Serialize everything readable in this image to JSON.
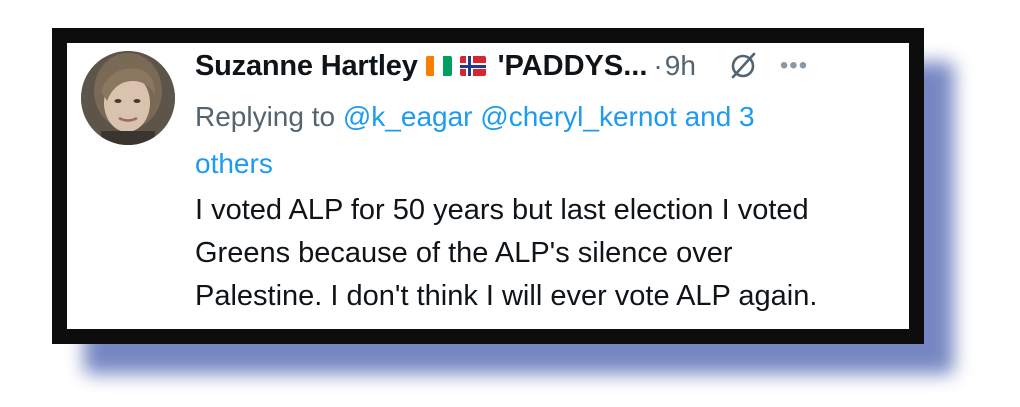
{
  "tweet": {
    "author_name": "Suzanne Hartley",
    "flags": [
      "cote-divoire-flag-icon",
      "norway-flag-icon"
    ],
    "handle_truncated": "'PADDYS...",
    "separator": "·",
    "time": "9h",
    "reply_prefix": "Replying to",
    "reply_mentions": [
      "@k_eagar",
      "@cheryl_kernot"
    ],
    "reply_and": "and 3",
    "reply_others": "others",
    "body_lines": [
      "I voted ALP for 50 years but last election I voted",
      "Greens because of the ALP's silence over",
      "Palestine. I don't think I will ever vote ALP again."
    ]
  },
  "colors": {
    "frame": "#0d0d0d",
    "shadow": "#5f72b8",
    "link": "#1d9bf0",
    "muted": "#536471",
    "text": "#0f1419"
  }
}
